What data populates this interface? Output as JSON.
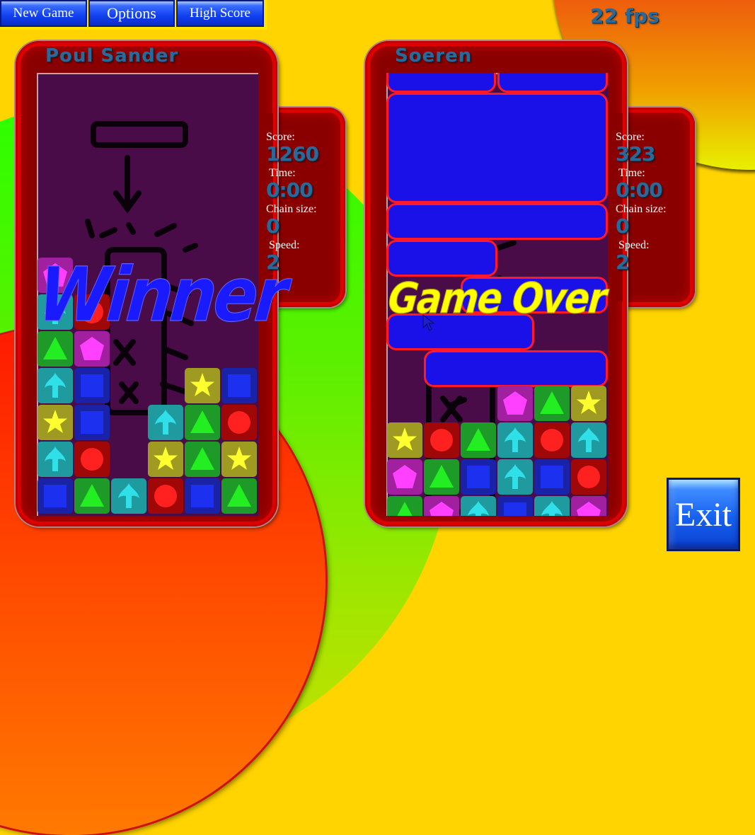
{
  "toolbar": {
    "new_game_label": "New Game",
    "options_label": "Options",
    "high_score_label": "High Score"
  },
  "fps": "22 fps",
  "exit_label": "Exit",
  "players": [
    {
      "name": "Poul Sander",
      "status": "Winner",
      "stats": {
        "score_label": "Score:",
        "score": "1260",
        "time_label": "Time:",
        "time": "0:00",
        "chain_label": "Chain size:",
        "chain": "0",
        "speed_label": "Speed:",
        "speed": "2"
      },
      "board_rows_bottom_up": [
        [
          "square",
          "triangle",
          "arrow",
          "circle",
          "square",
          "triangle"
        ],
        [
          "arrow",
          "circle",
          null,
          "star",
          "triangle",
          "star"
        ],
        [
          "star",
          "square",
          null,
          "arrow",
          "triangle",
          "circle"
        ],
        [
          "arrow",
          "square",
          null,
          null,
          "star",
          "square"
        ],
        [
          "triangle",
          "pentagon",
          null,
          null,
          null,
          null
        ],
        [
          "arrow",
          "circle",
          null,
          null,
          null,
          null
        ],
        [
          "pentagon",
          null,
          null,
          null,
          null,
          null
        ]
      ]
    },
    {
      "name": "Soeren",
      "status": "Game Over",
      "stats": {
        "score_label": "Score:",
        "score": "323",
        "time_label": "Time:",
        "time": "0:00",
        "chain_label": "Chain size:",
        "chain": "0",
        "speed_label": "Speed:",
        "speed": "2"
      },
      "board_rows_bottom_up": [
        [
          "triangle",
          "pentagon",
          "arrow",
          "square",
          "arrow",
          "pentagon"
        ],
        [
          "pentagon",
          "triangle",
          "square",
          "arrow",
          "square",
          "circle"
        ],
        [
          "star",
          "circle",
          "triangle",
          "arrow",
          "circle",
          "arrow"
        ],
        [
          null,
          null,
          null,
          "pentagon",
          "triangle",
          "star"
        ]
      ]
    }
  ],
  "block_colors": {
    "triangle": {
      "bg": "#1e9a28",
      "fg": "#22ee22"
    },
    "pentagon": {
      "bg": "#a020a0",
      "fg": "#ff40ff"
    },
    "arrow": {
      "bg": "#1f9a9e",
      "fg": "#30e0e8"
    },
    "square": {
      "bg": "#1a22a8",
      "fg": "#1c30f0"
    },
    "star": {
      "bg": "#9e9a22",
      "fg": "#ffff30"
    },
    "circle": {
      "bg": "#a00808",
      "fg": "#ff2020"
    }
  }
}
